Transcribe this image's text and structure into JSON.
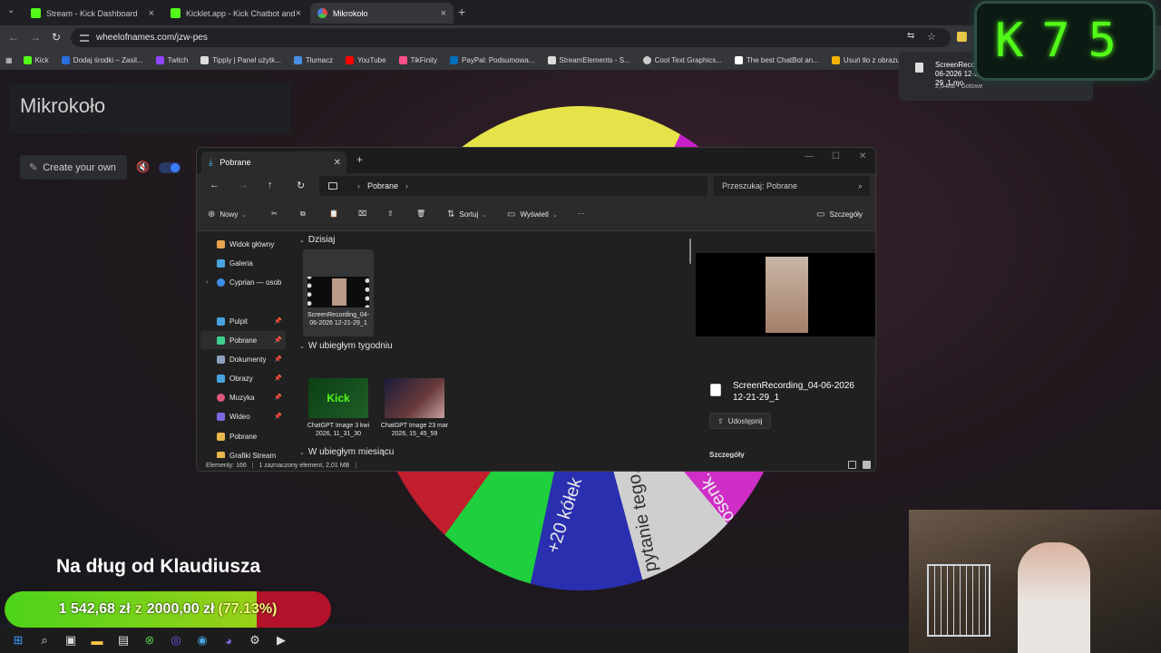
{
  "browser": {
    "tabs": [
      {
        "label": "Stream - Kick Dashboard",
        "fav_color": "#53fc18"
      },
      {
        "label": "Kicklet.app - Kick Chatbot and",
        "fav_color": "#53fc18"
      },
      {
        "label": "Mikrokoło",
        "fav_color": "#e04848"
      }
    ],
    "url": "wheelofnames.com/jzw-pes",
    "bookmarks": [
      {
        "label": "Kick",
        "color": "#53fc18"
      },
      {
        "label": "Dodaj środki – Zasil...",
        "color": "#2a6edb"
      },
      {
        "label": "Twitch",
        "color": "#9146ff"
      },
      {
        "label": "Tipply | Panel użytk...",
        "color": "#dddddd"
      },
      {
        "label": "Tłumacz",
        "color": "#4a90e2"
      },
      {
        "label": "YouTube",
        "color": "#ff0000"
      },
      {
        "label": "TikFinity",
        "color": "#ff4f8b"
      },
      {
        "label": "PayPal: Podsumowa...",
        "color": "#0070ba"
      },
      {
        "label": "StreamElements - S...",
        "color": "#dddddd"
      },
      {
        "label": "Cool Text Graphics...",
        "color": "#cccccc"
      },
      {
        "label": "The best ChatBot an...",
        "color": "#ffffff"
      },
      {
        "label": "Usuń tło z obrazu",
        "color": "#f5b300"
      }
    ]
  },
  "page": {
    "title": "Mikrokoło",
    "create_label": "Create your own"
  },
  "wheel": {
    "labels": [
      "+20 kółek",
      "pytanie tego...",
      "posenk..."
    ]
  },
  "explorer": {
    "tab_title": "Pobrane",
    "breadcrumb": "Pobrane",
    "search_placeholder": "Przeszukaj: Pobrane",
    "toolbar": {
      "new": "Nowy",
      "sort": "Sortuj",
      "view": "Wyświetl",
      "details": "Szczegóły"
    },
    "sidebar": [
      {
        "label": "Widok główny",
        "color": "#e8a24a",
        "pinned": false,
        "expand": false
      },
      {
        "label": "Galeria",
        "color": "#4aa3df",
        "pinned": false,
        "expand": false
      },
      {
        "label": "Cyprian — osob",
        "color": "#3a8ee6",
        "pinned": false,
        "expand": true
      },
      {
        "label": "Pulpit",
        "color": "#4aa3df",
        "pinned": true,
        "expand": false
      },
      {
        "label": "Pobrane",
        "color": "#3ecf8e",
        "pinned": true,
        "expand": false
      },
      {
        "label": "Dokumenty",
        "color": "#8aa0c0",
        "pinned": true,
        "expand": false
      },
      {
        "label": "Obrazy",
        "color": "#4aa3df",
        "pinned": true,
        "expand": false
      },
      {
        "label": "Muzyka",
        "color": "#e0567a",
        "pinned": true,
        "expand": false
      },
      {
        "label": "Wideo",
        "color": "#7a6ae0",
        "pinned": true,
        "expand": false
      },
      {
        "label": "Pobrane",
        "color": "#e8b64a",
        "pinned": false,
        "expand": false
      },
      {
        "label": "Grafiki Stream",
        "color": "#e8b64a",
        "pinned": false,
        "expand": false
      }
    ],
    "groups": [
      "Dzisiaj",
      "W ubiegłym tygodniu",
      "W ubiegłym miesiącu"
    ],
    "files": [
      {
        "name": "ScreenRecording_04-06-2026 12-21-29_1",
        "thumb": "video"
      },
      {
        "name": "ChatGPT Image 3 kwi 2026, 11_31_30",
        "thumb": "kick",
        "thumb_text": "Kick"
      },
      {
        "name": "ChatGPT Image 23 mar 2026, 15_45_59",
        "thumb": "anime"
      }
    ],
    "details": {
      "name": "ScreenRecording_04-06-2026 12-21-29_1",
      "share": "Udostępnij",
      "section": "Szczegóły"
    },
    "status": {
      "count": "Elementy: 166",
      "selected": "1 zaznaczony element, 2,01 MB"
    }
  },
  "download": {
    "name": "ScreenRecording_04-06-2026 12-21-29_1.mo",
    "status": "2,0 MB • Gotowe"
  },
  "kick_counter": {
    "letter": "K",
    "value": "75"
  },
  "goal": {
    "title": "Na dług od Klaudiusza",
    "current": "1 542,68 zł",
    "sep": "z",
    "target": "2000,00 zł",
    "percent_text": "(77.13%)",
    "progress": 0.7713
  }
}
